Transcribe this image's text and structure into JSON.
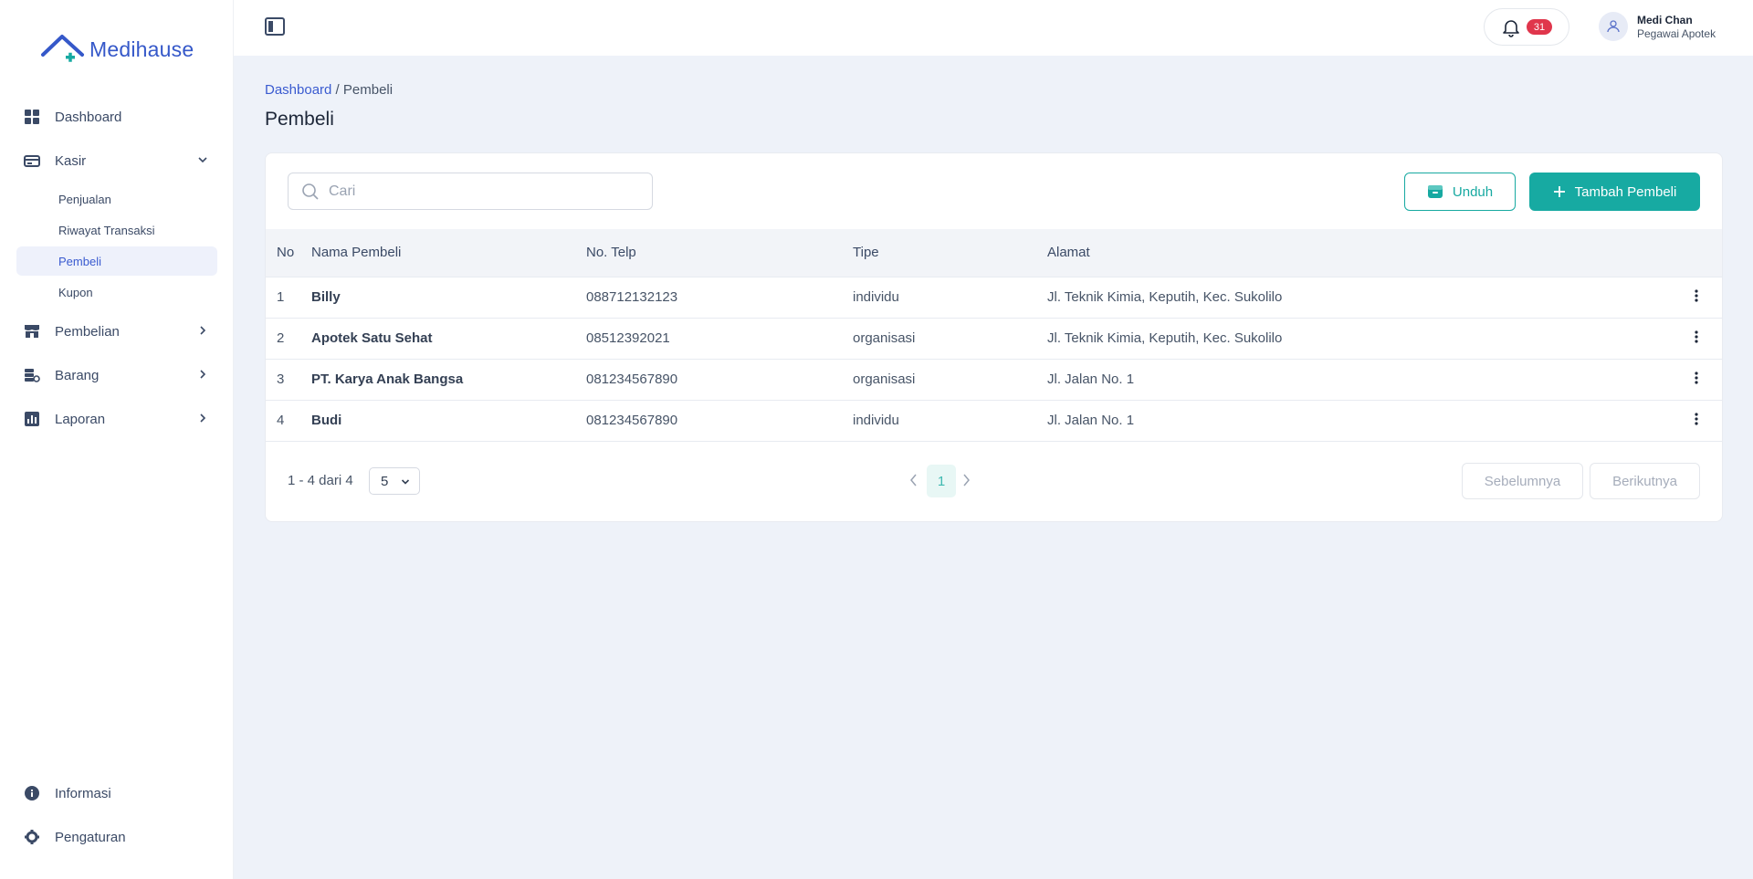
{
  "app": {
    "name": "Medihause",
    "brand_color": "#3558c9",
    "accent_color": "#17aaa2"
  },
  "sidebar": {
    "items": [
      {
        "label": "Dashboard",
        "icon": "grid-icon"
      },
      {
        "label": "Kasir",
        "icon": "cash-register-icon",
        "expanded": true,
        "children": [
          {
            "label": "Penjualan"
          },
          {
            "label": "Riwayat Transaksi"
          },
          {
            "label": "Pembeli",
            "active": true
          },
          {
            "label": "Kupon"
          }
        ]
      },
      {
        "label": "Pembelian",
        "icon": "store-icon"
      },
      {
        "label": "Barang",
        "icon": "boxes-icon"
      },
      {
        "label": "Laporan",
        "icon": "chart-icon"
      }
    ],
    "bottom": [
      {
        "label": "Informasi",
        "icon": "info-icon"
      },
      {
        "label": "Pengaturan",
        "icon": "gear-icon"
      }
    ]
  },
  "topbar": {
    "notification_count": "31",
    "user": {
      "name": "Medi Chan",
      "role": "Pegawai Apotek"
    }
  },
  "breadcrumb": {
    "root": "Dashboard",
    "separator": " / ",
    "current": "Pembeli"
  },
  "page": {
    "title": "Pembeli",
    "search_placeholder": "Cari",
    "download_label": "Unduh",
    "add_label": "Tambah Pembeli"
  },
  "table": {
    "columns": [
      "No",
      "Nama Pembeli",
      "No. Telp",
      "Tipe",
      "Alamat"
    ],
    "rows": [
      {
        "no": "1",
        "name": "Billy",
        "telp": "088712132123",
        "tipe": "individu",
        "alamat": "Jl. Teknik Kimia, Keputih, Kec. Sukolilo"
      },
      {
        "no": "2",
        "name": "Apotek Satu Sehat",
        "telp": "08512392021",
        "tipe": "organisasi",
        "alamat": "Jl. Teknik Kimia, Keputih, Kec. Sukolilo"
      },
      {
        "no": "3",
        "name": "PT. Karya Anak Bangsa",
        "telp": "081234567890",
        "tipe": "organisasi",
        "alamat": "Jl. Jalan No. 1"
      },
      {
        "no": "4",
        "name": "Budi",
        "telp": "081234567890",
        "tipe": "individu",
        "alamat": "Jl. Jalan No. 1"
      }
    ]
  },
  "pagination": {
    "info": "1 - 4 dari 4",
    "page_size": "5",
    "current_page": "1",
    "prev_label": "Sebelumnya",
    "next_label": "Berikutnya"
  }
}
